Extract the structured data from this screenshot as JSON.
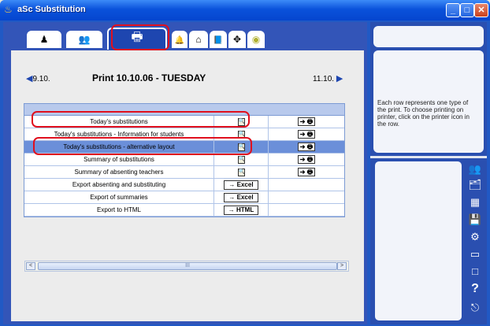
{
  "window": {
    "title": "aSc Substitution",
    "app_icon": "app-flame-icon",
    "controls": {
      "minimize": "_",
      "maximize": "□",
      "close": "✕"
    }
  },
  "tabs": [
    {
      "icon": "teacher-group-icon",
      "glyph": "♟"
    },
    {
      "icon": "people-icon",
      "glyph": "👥"
    },
    {
      "icon": "printer-icon",
      "glyph": "🖶",
      "active": true
    },
    {
      "icon": "bell-icon",
      "glyph": "🔔"
    },
    {
      "icon": "house-icon",
      "glyph": "⌂"
    },
    {
      "icon": "book-icon",
      "glyph": "📘"
    },
    {
      "icon": "arrows-icon",
      "glyph": "✥"
    },
    {
      "icon": "cd-icon",
      "glyph": "◉"
    }
  ],
  "nav": {
    "prev_date": "9.10.",
    "title": "Print 10.10.06 - TUESDAY",
    "next_date": "11.10."
  },
  "rows": [
    {
      "name": "Today's substitutions",
      "preview": true,
      "print": true,
      "selected": false
    },
    {
      "name": "Today's substitutions - Information for students",
      "preview": true,
      "print": true,
      "selected": false
    },
    {
      "name": "Today's substitutions - alternative layout",
      "preview": true,
      "print": true,
      "selected": true
    },
    {
      "name": "Summary of substitutions",
      "preview": true,
      "print": true,
      "selected": false
    },
    {
      "name": "Summary of absenting teachers",
      "preview": true,
      "print": true,
      "selected": false
    },
    {
      "name": "Export absenting and substituting",
      "export": "→ Excel"
    },
    {
      "name": "Export of summaries",
      "export": "→ Excel"
    },
    {
      "name": "Export to HTML",
      "export": "→ HTML"
    }
  ],
  "print_button_label": "➔ 🖶",
  "preview_glyph": "🔍",
  "scrollbar": {
    "thumb_grip": "III",
    "left_arrow": "<",
    "right_arrow": ">"
  },
  "info_text": "Each row represents one type of the print. To choose printing on printer, click on the printer icon in the row.",
  "side_tools": [
    {
      "icon": "teachers-icon",
      "glyph": "👥"
    },
    {
      "icon": "classes-icon",
      "glyph": "🗂"
    },
    {
      "icon": "timetable-icon",
      "glyph": "▦"
    },
    {
      "icon": "save-icon",
      "glyph": "💾"
    },
    {
      "icon": "tools-icon",
      "glyph": "⚙"
    },
    {
      "icon": "window-icon",
      "glyph": "▭"
    },
    {
      "icon": "blank-window-icon",
      "glyph": "□"
    },
    {
      "icon": "help-icon",
      "glyph": "?"
    },
    {
      "icon": "exit-icon",
      "glyph": "⎋"
    }
  ],
  "colors": {
    "title_bar": "#0A52DB",
    "highlight_outline": "#E0101E",
    "selected_row": "#6B8FD9"
  }
}
